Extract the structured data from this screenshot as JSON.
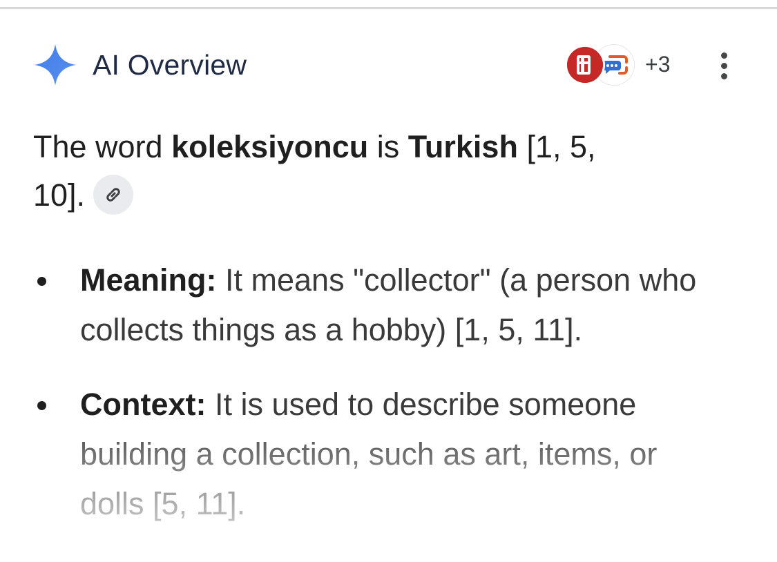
{
  "header": {
    "title": "AI Overview",
    "sources_more": "+3",
    "icons": [
      "sparkle-icon",
      "source-icon-t",
      "source-icon-translate",
      "more-vert-icon"
    ]
  },
  "intro": {
    "part1": "The word ",
    "term": "koleksiyoncu",
    "part2": " is ",
    "language": "Turkish",
    "citation": " [1, 5, 10].",
    "link_icon": "link-icon"
  },
  "bullets": [
    {
      "label": "Meaning:",
      "text": " It means \"collector\" (a person who collects things as a hobby) [1, 5, 11]."
    },
    {
      "label": "Context:",
      "text": " It is used to describe someone building a collection, such as art, items, or dolls [5, 11]."
    }
  ],
  "colors": {
    "title": "#1f2a44",
    "sparkle": "#4a86e8",
    "source_red": "#c62828",
    "chip_bg": "#e9ebee"
  }
}
